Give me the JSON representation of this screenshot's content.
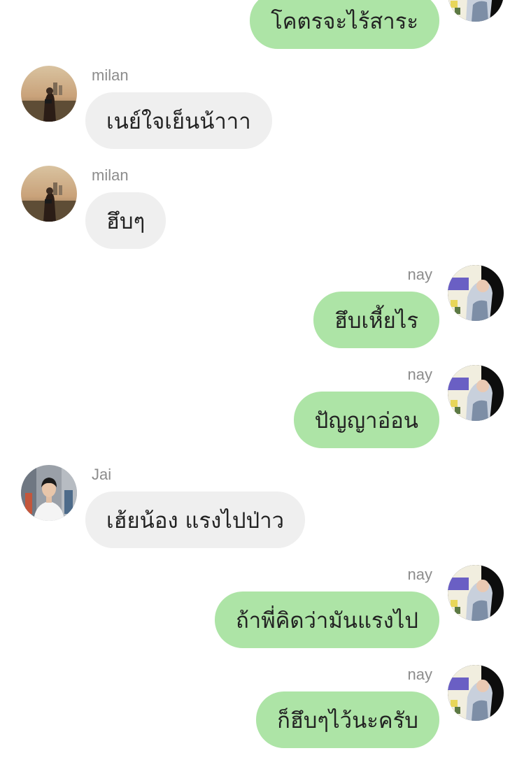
{
  "messages": [
    {
      "side": "right",
      "sender": "",
      "text": "โคตรจะไร้สาระ"
    },
    {
      "side": "left",
      "sender": "milan",
      "text": "เนย์ใจเย็นน้าาา"
    },
    {
      "side": "left",
      "sender": "milan",
      "text": "ฮึบๆ"
    },
    {
      "side": "right",
      "sender": "nay",
      "text": "ฮึบเหี้ยไร"
    },
    {
      "side": "right",
      "sender": "nay",
      "text": "ปัญญาอ่อน"
    },
    {
      "side": "left",
      "sender": "Jai",
      "text": "เฮ้ยน้อง แรงไปป่าว"
    },
    {
      "side": "right",
      "sender": "nay",
      "text": "ถ้าพี่คิดว่ามันแรงไป"
    },
    {
      "side": "right",
      "sender": "nay",
      "text": "ก็ฮึบๆไว้นะครับ"
    }
  ],
  "colors": {
    "outgoing_bubble": "#ade4a6",
    "incoming_bubble": "#efefef",
    "sender_name": "#8c8c8c",
    "message_text": "#222222"
  }
}
